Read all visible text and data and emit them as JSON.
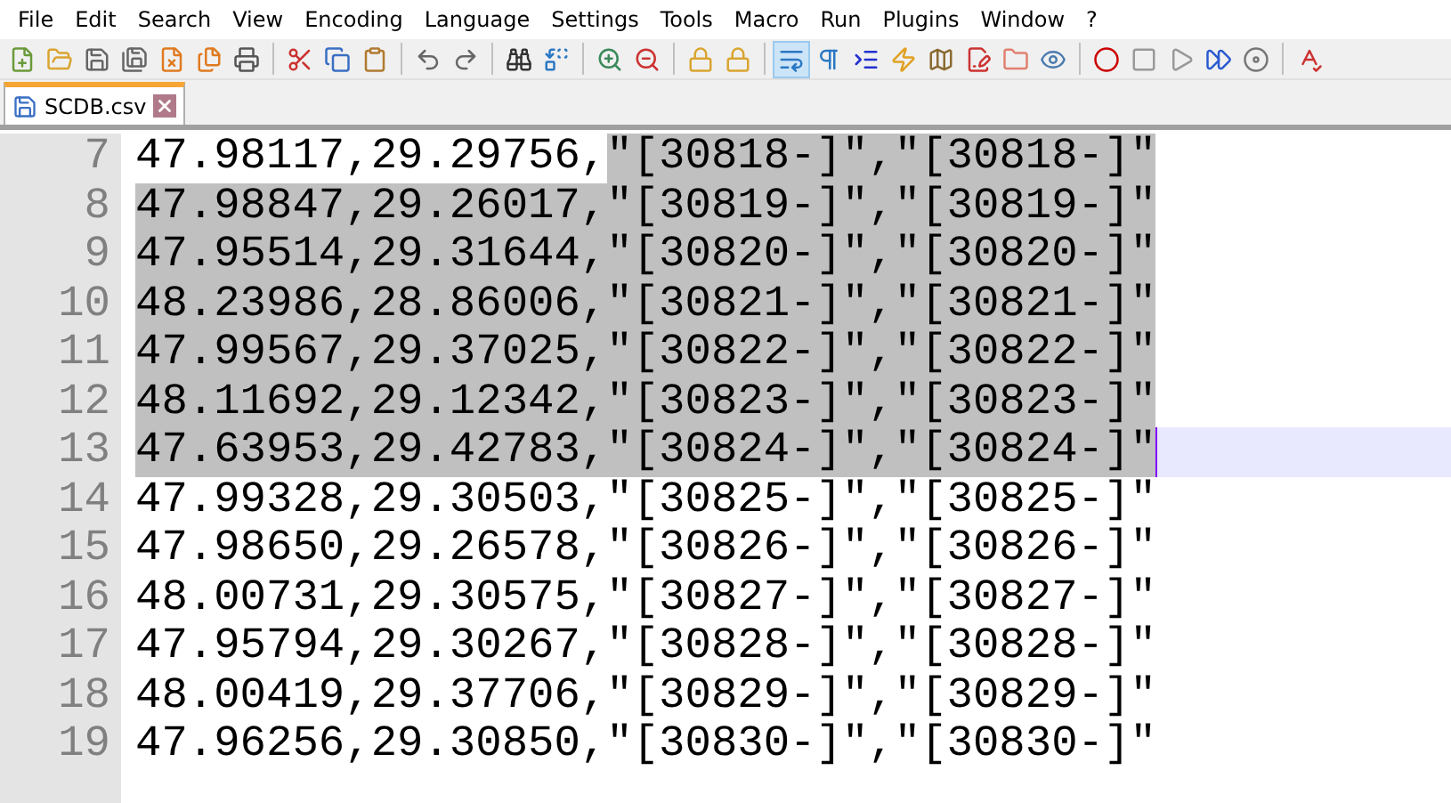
{
  "menu": [
    "File",
    "Edit",
    "Search",
    "View",
    "Encoding",
    "Language",
    "Settings",
    "Tools",
    "Macro",
    "Run",
    "Plugins",
    "Window",
    "?"
  ],
  "toolbar": {
    "word_wrap_on": true
  },
  "tabs": [
    {
      "label": "SCDB.csv",
      "selected": true
    }
  ],
  "lines": [
    {
      "number": "7",
      "current": false,
      "segments": [
        {
          "text": "47.98117,29.29756,",
          "selected": false
        },
        {
          "text": "\"[30818-]\",\"[30818-]\"",
          "selected": true
        }
      ]
    },
    {
      "number": "8",
      "current": false,
      "segments": [
        {
          "text": "47.98847,29.26017,\"[30819-]\",\"[30819-]\"",
          "selected": true
        }
      ]
    },
    {
      "number": "9",
      "current": false,
      "segments": [
        {
          "text": "47.95514,29.31644,\"[30820-]\",\"[30820-]\"",
          "selected": true
        }
      ]
    },
    {
      "number": "10",
      "current": false,
      "segments": [
        {
          "text": "48.23986,28.86006,\"[30821-]\",\"[30821-]\"",
          "selected": true
        }
      ]
    },
    {
      "number": "11",
      "current": false,
      "segments": [
        {
          "text": "47.99567,29.37025,\"[30822-]\",\"[30822-]\"",
          "selected": true
        }
      ]
    },
    {
      "number": "12",
      "current": false,
      "segments": [
        {
          "text": "48.11692,29.12342,\"[30823-]\",\"[30823-]\"",
          "selected": true
        }
      ]
    },
    {
      "number": "13",
      "current": true,
      "segments": [
        {
          "text": "47.63953,29.42783,\"[30824-]\",\"[30824-]\"",
          "selected": true
        }
      ]
    },
    {
      "number": "14",
      "current": false,
      "segments": [
        {
          "text": "47.99328,29.30503,\"[30825-]\",\"[30825-]\"",
          "selected": false
        }
      ]
    },
    {
      "number": "15",
      "current": false,
      "segments": [
        {
          "text": "47.98650,29.26578,\"[30826-]\",\"[30826-]\"",
          "selected": false
        }
      ]
    },
    {
      "number": "16",
      "current": false,
      "segments": [
        {
          "text": "48.00731,29.30575,\"[30827-]\",\"[30827-]\"",
          "selected": false
        }
      ]
    },
    {
      "number": "17",
      "current": false,
      "segments": [
        {
          "text": "47.95794,29.30267,\"[30828-]\",\"[30828-]\"",
          "selected": false
        }
      ]
    },
    {
      "number": "18",
      "current": false,
      "segments": [
        {
          "text": "48.00419,29.37706,\"[30829-]\",\"[30829-]\"",
          "selected": false
        }
      ]
    },
    {
      "number": "19",
      "current": false,
      "segments": [
        {
          "text": "47.96256,29.30850,\"[30830-]\",\"[30830-]\"",
          "selected": false
        }
      ]
    }
  ]
}
